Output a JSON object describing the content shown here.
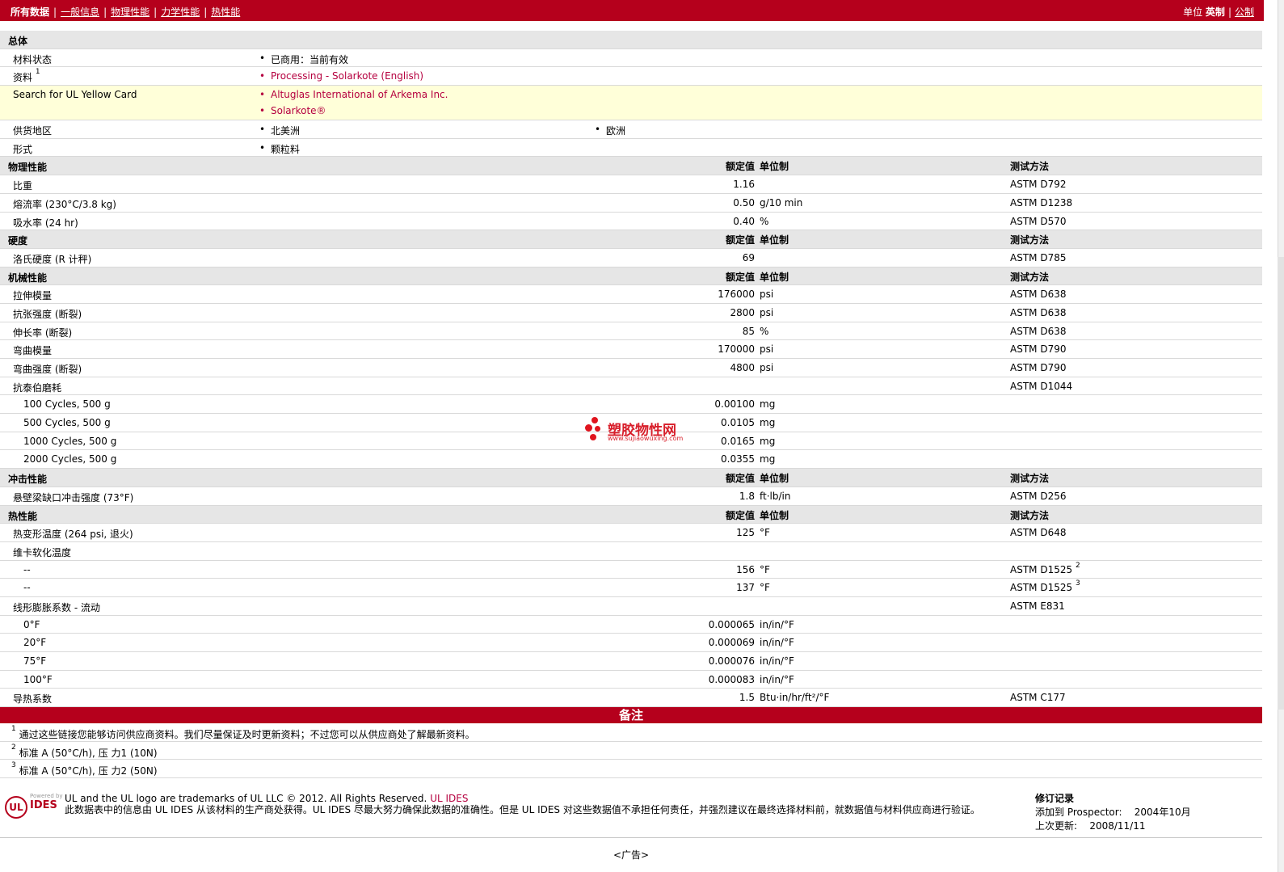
{
  "nav": {
    "tabs": [
      {
        "label": "所有数据"
      },
      {
        "label": "一般信息"
      },
      {
        "label": "物理性能"
      },
      {
        "label": "力学性能"
      },
      {
        "label": "热性能"
      }
    ],
    "unit_label": "单位",
    "unit_options": [
      {
        "label": "英制"
      },
      {
        "label": "公制"
      }
    ]
  },
  "general": {
    "title": "总体",
    "status_label": "材料状态",
    "status_value": "已商用：当前有效",
    "docs_label": "资料",
    "docs_sup": "1",
    "docs_link": "Processing - Solarkote (English)",
    "yellow_label": "Search for UL Yellow Card",
    "yellow_links": [
      "Altuglas International of Arkema Inc.",
      "Solarkote®"
    ],
    "supply_label": "供货地区",
    "supply_values": [
      "北美洲",
      "欧洲"
    ],
    "form_label": "形式",
    "form_value": "颗粒料"
  },
  "col_headers": {
    "nominal": "额定值",
    "unit": "单位制",
    "method": "测试方法"
  },
  "sections": [
    {
      "title": "物理性能",
      "rows": [
        {
          "label": "比重",
          "value": "1.16",
          "unit": "",
          "method": "ASTM D792"
        },
        {
          "label": "熔流率  (230°C/3.8 kg)",
          "value": "0.50",
          "unit": "g/10 min",
          "method": "ASTM D1238"
        },
        {
          "label": "吸水率  (24 hr)",
          "value": "0.40",
          "unit": "%",
          "method": "ASTM D570"
        }
      ]
    },
    {
      "title": "硬度",
      "rows": [
        {
          "label": "洛氏硬度  (R 计秤)",
          "value": "69",
          "unit": "",
          "method": "ASTM D785"
        }
      ]
    },
    {
      "title": "机械性能",
      "rows": [
        {
          "label": "拉伸模量",
          "value": "176000",
          "unit": "psi",
          "method": "ASTM D638"
        },
        {
          "label": "抗张强度  (断裂)",
          "value": "2800",
          "unit": "psi",
          "method": "ASTM D638"
        },
        {
          "label": "伸长率  (断裂)",
          "value": "85",
          "unit": "%",
          "method": "ASTM D638"
        },
        {
          "label": "弯曲模量",
          "value": "170000",
          "unit": "psi",
          "method": "ASTM D790"
        },
        {
          "label": "弯曲强度  (断裂)",
          "value": "4800",
          "unit": "psi",
          "method": "ASTM D790"
        },
        {
          "label": "抗泰伯磨耗",
          "value": "",
          "unit": "",
          "method": "ASTM D1044"
        },
        {
          "label": "100 Cycles, 500 g",
          "value": "0.00100",
          "unit": "mg",
          "method": "",
          "sub": true
        },
        {
          "label": "500 Cycles, 500 g",
          "value": "0.0105",
          "unit": "mg",
          "method": "",
          "sub": true
        },
        {
          "label": "1000 Cycles, 500 g",
          "value": "0.0165",
          "unit": "mg",
          "method": "",
          "sub": true
        },
        {
          "label": "2000 Cycles, 500 g",
          "value": "0.0355",
          "unit": "mg",
          "method": "",
          "sub": true
        }
      ]
    },
    {
      "title": "冲击性能",
      "rows": [
        {
          "label": "悬壁梁缺口冲击强度  (73°F)",
          "value": "1.8",
          "unit": "ft·lb/in",
          "method": "ASTM D256"
        }
      ]
    },
    {
      "title": "热性能",
      "rows": [
        {
          "label": "热变形温度  (264 psi, 退火)",
          "value": "125",
          "unit": "°F",
          "method": "ASTM D648"
        },
        {
          "label": "维卡软化温度",
          "value": "",
          "unit": "",
          "method": ""
        },
        {
          "label": "--",
          "value": "156",
          "unit": "°F",
          "method": "ASTM D1525",
          "method_sup": "2",
          "sub": true
        },
        {
          "label": "--",
          "value": "137",
          "unit": "°F",
          "method": "ASTM D1525",
          "method_sup": "3",
          "sub": true
        },
        {
          "label": "线形膨胀系数  - 流动",
          "value": "",
          "unit": "",
          "method": "ASTM E831"
        },
        {
          "label": "0°F",
          "value": "0.000065",
          "unit": "in/in/°F",
          "method": "",
          "sub": true
        },
        {
          "label": "20°F",
          "value": "0.000069",
          "unit": "in/in/°F",
          "method": "",
          "sub": true
        },
        {
          "label": "75°F",
          "value": "0.000076",
          "unit": "in/in/°F",
          "method": "",
          "sub": true
        },
        {
          "label": "100°F",
          "value": "0.000083",
          "unit": "in/in/°F",
          "method": "",
          "sub": true
        },
        {
          "label": "导热系数",
          "value": "1.5",
          "unit": "Btu·in/hr/ft²/°F",
          "method": "ASTM C177"
        }
      ]
    }
  ],
  "notes": {
    "title": "备注",
    "items": [
      {
        "num": "1",
        "text": "通过这些链接您能够访问供应商资料。我们尽量保证及时更新资料；不过您可以从供应商处了解最新资料。"
      },
      {
        "num": "2",
        "text": "标准  A (50°C/h), 压  力1 (10N)"
      },
      {
        "num": "3",
        "text": "标准  A (50°C/h), 压  力2 (50N)"
      }
    ]
  },
  "footer": {
    "logo_ul": "UL",
    "logo_ides": "IDES",
    "powered": "Powered by",
    "trademark": "UL and the UL logo are trademarks of UL LLC © 2012. All Rights Reserved.",
    "trademark_link": "UL IDES",
    "disclaimer": "此数据表中的信息由  UL IDES 从该材料的生产商处获得。UL IDES 尽最大努力确保此数据的准确性。但是  UL IDES 对这些数据值不承担任何责任，并强烈建议在最终选择材料前，就数据值与材料供应商进行验证。",
    "revision_title": "修订记录",
    "added_label": "添加到  Prospector:",
    "added_value": "2004年10月",
    "updated_label": "上次更新:",
    "updated_value": "2008/11/11",
    "ad": "<广告>"
  },
  "watermark": {
    "text": "塑胶物性网",
    "url": "www.sujiaowuxing.com"
  }
}
